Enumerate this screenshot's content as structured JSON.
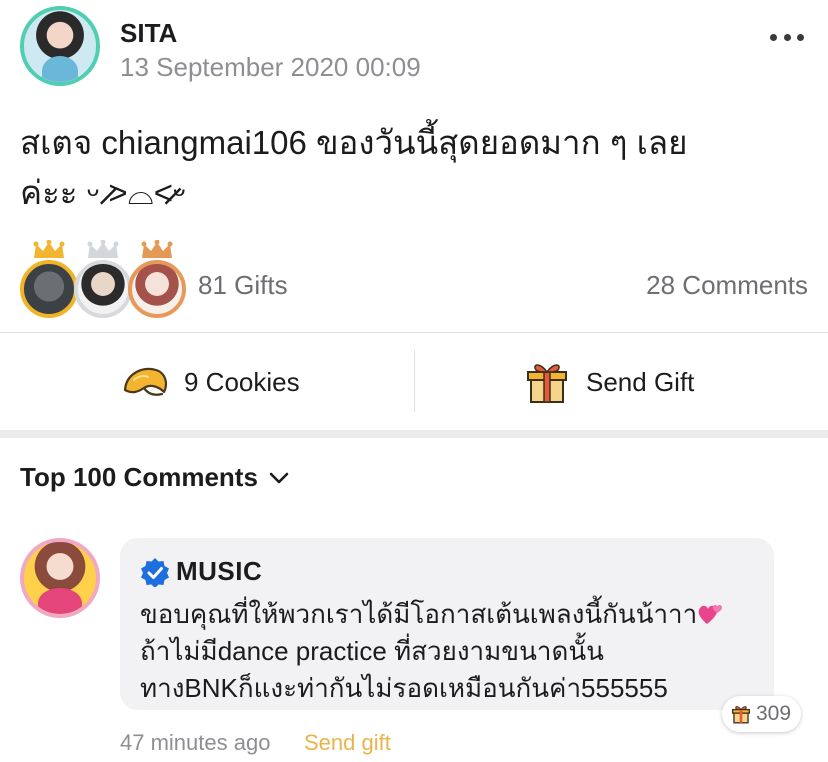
{
  "post": {
    "author_name": "SITA",
    "timestamp": "13 September 2020 00:09",
    "text_line1": "สเตจ chiangmai106 ของวันนี้สุดยอดมาก ๆ เลย",
    "text_line2": "ค่ะะ ᵕ ̷̷>⌓<̷̷ᵕ",
    "gifts_count": "81 Gifts",
    "comments_count": "28 Comments"
  },
  "actions": {
    "cookies_label": "9 Cookies",
    "send_gift_label": "Send Gift"
  },
  "comments_section": {
    "heading": "Top 100 Comments",
    "comment": {
      "author": "MUSIC",
      "lines": [
        "ขอบคุณที่ให้พวกเราได้มีโอกาสเต้นเพลงนี้กันน้าาา",
        "ถ้าไม่มีdance practice ที่สวยงามขนาดนั้น",
        "ทางBNKก็แงะท่ากันไม่รอดเหมือนกันค่า555555"
      ],
      "gift_count": "309",
      "time": "47 minutes ago",
      "send_gift_link": "Send gift"
    }
  },
  "colors": {
    "accent_gold": "#e8b54a",
    "verified_blue": "#1d6fe0",
    "heart_pink": "#e9458d"
  }
}
